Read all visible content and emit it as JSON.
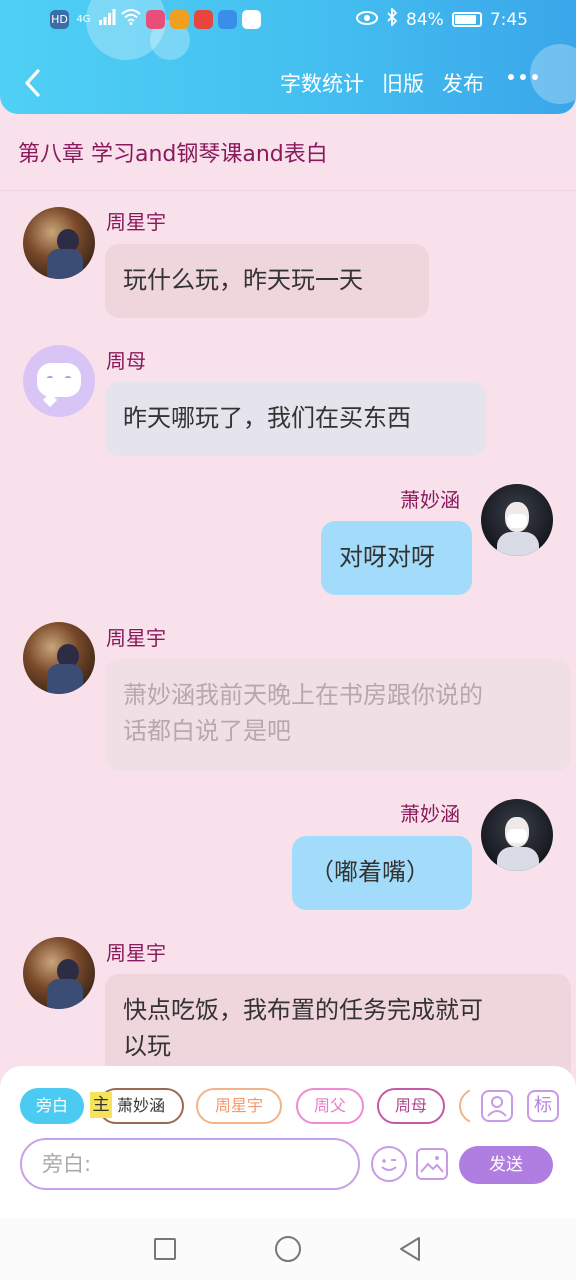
{
  "status_bar": {
    "left_labels": [
      "HD",
      "4G"
    ],
    "battery": "84%",
    "time": "7:45"
  },
  "header": {
    "actions": [
      "字数统计",
      "旧版",
      "发布"
    ]
  },
  "chapter_title": "第八章  学习and钢琴课and表白",
  "messages": [
    {
      "speaker": "周星宇",
      "text": "玩什么玩，昨天玩一天"
    },
    {
      "speaker": "周母",
      "text": "昨天哪玩了，我们在买东西"
    },
    {
      "speaker": "萧妙涵",
      "text": "对呀对呀"
    },
    {
      "speaker": "周星宇",
      "text_line1": "萧妙涵我前天晚上在书房跟你说的",
      "text_line2": "话都白说了是吧"
    },
    {
      "speaker": "萧妙涵",
      "text": "（嘟着嘴）"
    },
    {
      "speaker": "周星宇",
      "text_line1": "快点吃饭，我布置的任务完成就可",
      "text_line2": "以玩"
    }
  ],
  "composer": {
    "chips": [
      "旁白",
      "萧妙涵",
      "周星宇",
      "周父",
      "周母"
    ],
    "main_tag": "主",
    "tag_button": "标",
    "input_placeholder": "旁白:",
    "send_label": "发送"
  },
  "colors": {
    "header_gradient_start": "#4fd0f5",
    "header_gradient_end": "#3aa6ea",
    "page_background": "#f9e1ec",
    "name_color": "#8a1a5b",
    "right_bubble": "#a3dcfa",
    "send_button": "#b07de0"
  }
}
